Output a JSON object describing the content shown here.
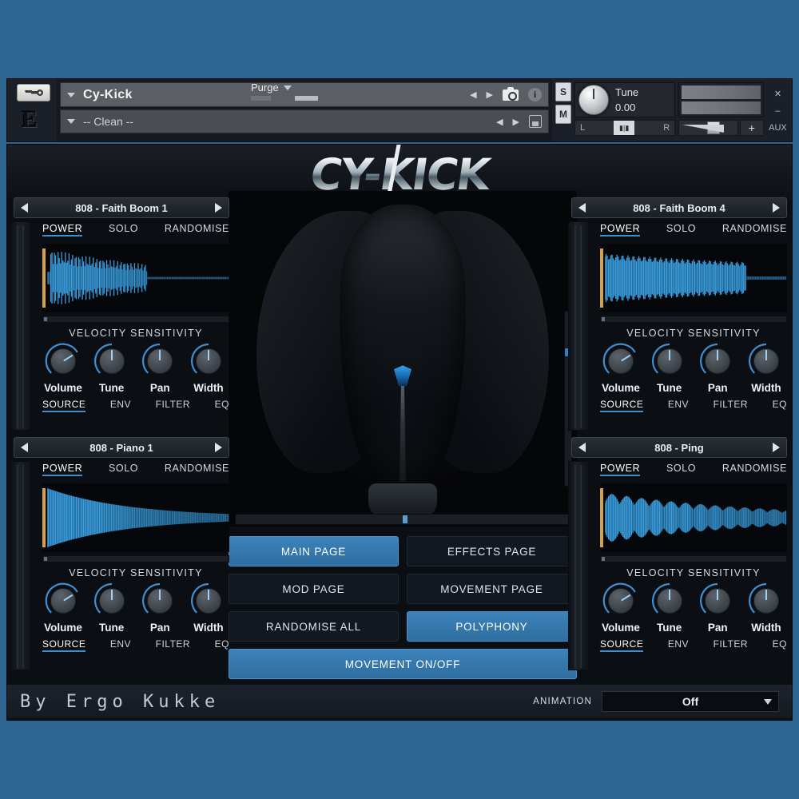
{
  "theme": {
    "page_bg": "#2d6490",
    "accent": "#3f8fd0",
    "panel_bg": "#0b0e13",
    "active_btn": "#3c82ba",
    "waveform": "#3a9fe0",
    "marker": "#d4a24a"
  },
  "host": {
    "wrench_icon": "wrench-icon",
    "logo_letter": "E",
    "instrument_name": "Cy-Kick",
    "snapshot_name": "-- Clean --",
    "nav_prev_icon": "prev-arrow-icon",
    "nav_next_icon": "next-arrow-icon",
    "camera_icon": "camera-icon",
    "info_icon": "info-icon",
    "save_icon": "floppy-disk-icon",
    "purge_label": "Purge",
    "solo_label": "S",
    "mute_label": "M",
    "tune_label": "Tune",
    "tune_value": "0.00",
    "pan_left": "L",
    "pan_right": "R",
    "volume_plus": "+",
    "close_icon": "close-icon",
    "minimize_icon": "minimize-icon",
    "aux_label": "AUX"
  },
  "plugin": {
    "logo": "CY-KICK",
    "center_art": "cyborg-face-artwork"
  },
  "slots": [
    {
      "id": "slot-1",
      "position": "top-left",
      "preset": "808 - Faith Boom 1",
      "prev_icon": "prev-arrow-icon",
      "next_icon": "next-arrow-icon",
      "top_tabs": [
        {
          "label": "POWER",
          "active": true
        },
        {
          "label": "SOLO",
          "active": false
        },
        {
          "label": "RANDOMISE",
          "active": false
        }
      ],
      "velocity_label": "VELOCITY SENSITIVITY",
      "knobs": [
        {
          "label": "Volume",
          "angle": 58
        },
        {
          "label": "Tune",
          "angle": 0
        },
        {
          "label": "Pan",
          "angle": 0
        },
        {
          "label": "Width",
          "angle": 0
        }
      ],
      "bottom_tabs": [
        {
          "label": "SOURCE",
          "active": true
        },
        {
          "label": "ENV",
          "active": false
        },
        {
          "label": "FILTER",
          "active": false
        },
        {
          "label": "EQ",
          "active": false
        }
      ],
      "waveform": "dense-decay-burst"
    },
    {
      "id": "slot-2",
      "position": "bottom-left",
      "preset": "808 - Piano 1",
      "prev_icon": "prev-arrow-icon",
      "next_icon": "next-arrow-icon",
      "top_tabs": [
        {
          "label": "POWER",
          "active": true
        },
        {
          "label": "SOLO",
          "active": false
        },
        {
          "label": "RANDOMISE",
          "active": false
        }
      ],
      "velocity_label": "VELOCITY SENSITIVITY",
      "knobs": [
        {
          "label": "Volume",
          "angle": 58
        },
        {
          "label": "Tune",
          "angle": 0
        },
        {
          "label": "Pan",
          "angle": 0
        },
        {
          "label": "Width",
          "angle": 0
        }
      ],
      "bottom_tabs": [
        {
          "label": "SOURCE",
          "active": true
        },
        {
          "label": "ENV",
          "active": false
        },
        {
          "label": "FILTER",
          "active": false
        },
        {
          "label": "EQ",
          "active": false
        }
      ],
      "waveform": "smooth-taper"
    },
    {
      "id": "slot-3",
      "position": "top-right",
      "preset": "808 - Faith Boom 4",
      "prev_icon": "prev-arrow-icon",
      "next_icon": "next-arrow-icon",
      "top_tabs": [
        {
          "label": "POWER",
          "active": true
        },
        {
          "label": "SOLO",
          "active": false
        },
        {
          "label": "RANDOMISE",
          "active": false
        }
      ],
      "velocity_label": "VELOCITY SENSITIVITY",
      "knobs": [
        {
          "label": "Volume",
          "angle": 58
        },
        {
          "label": "Tune",
          "angle": 0
        },
        {
          "label": "Pan",
          "angle": 0
        },
        {
          "label": "Width",
          "angle": 0
        }
      ],
      "bottom_tabs": [
        {
          "label": "SOURCE",
          "active": true
        },
        {
          "label": "ENV",
          "active": false
        },
        {
          "label": "FILTER",
          "active": false
        },
        {
          "label": "EQ",
          "active": false
        }
      ],
      "waveform": "wide-sustain"
    },
    {
      "id": "slot-4",
      "position": "bottom-right",
      "preset": "808 - Ping",
      "prev_icon": "prev-arrow-icon",
      "next_icon": "next-arrow-icon",
      "top_tabs": [
        {
          "label": "POWER",
          "active": true
        },
        {
          "label": "SOLO",
          "active": false
        },
        {
          "label": "RANDOMISE",
          "active": false
        }
      ],
      "velocity_label": "VELOCITY SENSITIVITY",
      "knobs": [
        {
          "label": "Volume",
          "angle": 58
        },
        {
          "label": "Tune",
          "angle": 0
        },
        {
          "label": "Pan",
          "angle": 0
        },
        {
          "label": "Width",
          "angle": 0
        }
      ],
      "bottom_tabs": [
        {
          "label": "SOURCE",
          "active": true
        },
        {
          "label": "ENV",
          "active": false
        },
        {
          "label": "FILTER",
          "active": false
        },
        {
          "label": "EQ",
          "active": false
        }
      ],
      "waveform": "long-comb-decay"
    }
  ],
  "page_buttons": [
    {
      "label": "MAIN PAGE",
      "active": true
    },
    {
      "label": "EFFECTS PAGE",
      "active": false
    },
    {
      "label": "MOD PAGE",
      "active": false
    },
    {
      "label": "MOVEMENT PAGE",
      "active": false
    },
    {
      "label": "RANDOMISE ALL",
      "active": false
    },
    {
      "label": "POLYPHONY",
      "active": true
    },
    {
      "label": "MOVEMENT ON/OFF",
      "active": true
    }
  ],
  "footer": {
    "credit": "By Ergo Kukke",
    "animation_label": "ANIMATION",
    "animation_value": "Off",
    "animation_chevron": "chevron-down-icon"
  }
}
